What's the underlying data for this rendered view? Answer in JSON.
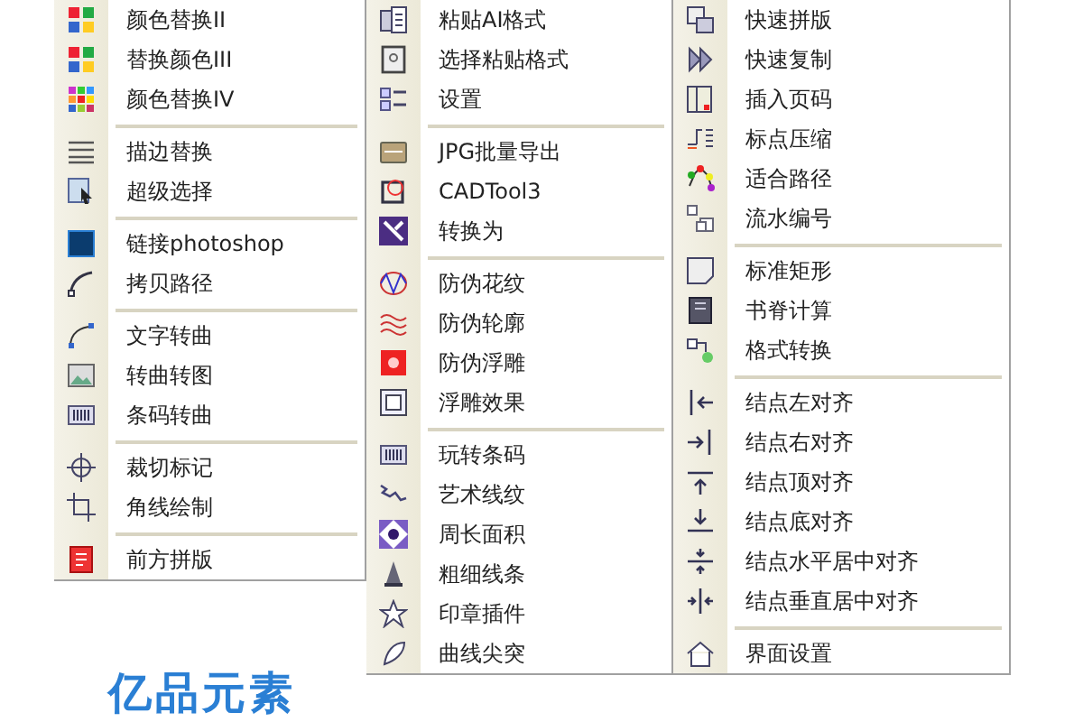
{
  "menus": [
    {
      "sections": [
        {
          "items": [
            "颜色替换II",
            "替换颜色III",
            "颜色替换IV"
          ]
        },
        {
          "items": [
            "描边替换",
            "超级选择"
          ]
        },
        {
          "items": [
            "链接photoshop",
            "拷贝路径"
          ]
        },
        {
          "items": [
            "文字转曲",
            "转曲转图",
            "条码转曲"
          ]
        },
        {
          "items": [
            "裁切标记",
            "角线绘制"
          ]
        },
        {
          "items": [
            "前方拼版"
          ]
        }
      ]
    },
    {
      "sections": [
        {
          "items": [
            "粘贴AI格式",
            "选择粘贴格式",
            "设置"
          ]
        },
        {
          "items": [
            "JPG批量导出",
            "CADTool3",
            "转换为"
          ]
        },
        {
          "items": [
            "防伪花纹",
            "防伪轮廓",
            "防伪浮雕",
            "浮雕效果"
          ]
        },
        {
          "items": [
            "玩转条码",
            "艺术线纹",
            "周长面积",
            "粗细线条",
            "印章插件",
            "曲线尖突"
          ]
        }
      ]
    },
    {
      "sections": [
        {
          "items": [
            "快速拼版",
            "快速复制",
            "插入页码",
            "标点压缩",
            "适合路径",
            "流水编号"
          ]
        },
        {
          "items": [
            "标准矩形",
            "书脊计算",
            "格式转换"
          ]
        },
        {
          "items": [
            "结点左对齐",
            "结点右对齐",
            "结点顶对齐",
            "结点底对齐",
            "结点水平居中对齐",
            "结点垂直居中对齐"
          ]
        },
        {
          "items": [
            "界面设置"
          ]
        }
      ]
    }
  ],
  "logo": {
    "text": "亿品元素"
  }
}
